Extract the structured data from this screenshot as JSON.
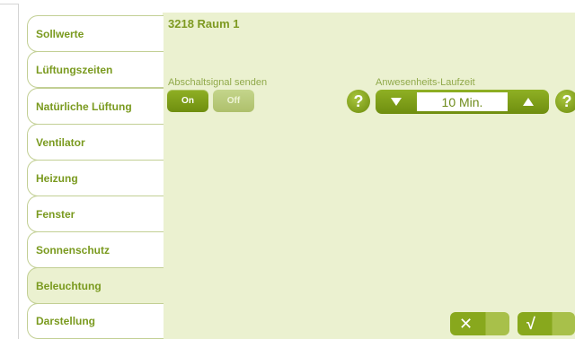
{
  "sidebar": {
    "items": [
      {
        "label": "Sollwerte"
      },
      {
        "label": "Lüftungszeiten"
      },
      {
        "label": "Natürliche Lüftung"
      },
      {
        "label": "Ventilator"
      },
      {
        "label": "Heizung"
      },
      {
        "label": "Fenster"
      },
      {
        "label": "Sonnenschutz"
      },
      {
        "label": "Beleuchtung",
        "active": true
      },
      {
        "label": "Darstellung"
      }
    ]
  },
  "main": {
    "title": "3218 Raum 1",
    "abschaltsignal": {
      "label": "Abschaltsignal senden",
      "on_label": "On",
      "off_label": "Off",
      "selected": "On"
    },
    "anwesenheit": {
      "label": "Anwesenheits-Laufzeit",
      "value": "10 Min.",
      "help_label": "?"
    }
  },
  "actions": {
    "cancel_icon": "close-icon",
    "confirm_icon": "check-icon",
    "cancel_glyph": "✕",
    "confirm_glyph": "√"
  },
  "colors": {
    "accent": "#7a9a1f",
    "panel_bg": "#ebf1d0",
    "button_active": "#7a9a1f",
    "button_inactive": "#b8c97a"
  }
}
